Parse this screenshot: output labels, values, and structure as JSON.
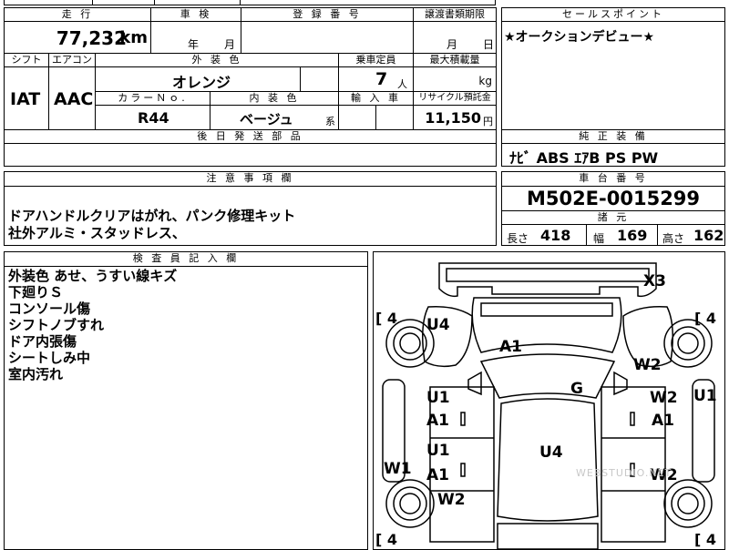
{
  "header_cut": {
    "top_left": "",
    "middle": "",
    "right_fragment": ""
  },
  "mileage": {
    "label": "走 行",
    "value": "77,232",
    "unit": "km"
  },
  "inspection": {
    "label": "車 検",
    "year_label": "年",
    "month_label": "月"
  },
  "registration": {
    "label": "登 録 番 号",
    "value": ""
  },
  "transfer_deadline": {
    "label": "譲渡書類期限",
    "month_label": "月",
    "day_label": "日"
  },
  "sales_point": {
    "label": "セールスポイント",
    "text": "★オークションデビュー★"
  },
  "shift": {
    "label": "シフト",
    "value": "IAT"
  },
  "aircon": {
    "label": "エアコン",
    "value": "AAC"
  },
  "exterior_color": {
    "label": "外 装 色",
    "value": "オレンジ"
  },
  "capacity": {
    "label": "乗車定員",
    "value": "7",
    "unit": "人"
  },
  "max_load": {
    "label": "最大積載量",
    "value": "",
    "unit": "kg"
  },
  "color_no": {
    "label": "カラーＮｏ.",
    "value": "R44"
  },
  "interior_color": {
    "label": "内 装 色",
    "value": "ベージュ",
    "suffix": "系"
  },
  "import": {
    "label": "輸 入 車",
    "value": ""
  },
  "recycle": {
    "label": "リサイクル預託金",
    "value": "11,150",
    "unit": "円"
  },
  "later_parts": {
    "label": "後 日 発 送 部 品",
    "value": ""
  },
  "genuine_equipment": {
    "label": "純 正 装 備",
    "value": "ﾅﾋﾞ ABS ｴｱB PS PW"
  },
  "notes": {
    "label": "注 意 事 項 欄",
    "lines": [
      "ドアハンドルクリアはがれ、パンク修理キット",
      "社外アルミ・スタッドレス、"
    ]
  },
  "chassis": {
    "label": "車 台 番 号",
    "value": "M502E-0015299"
  },
  "specs": {
    "label": "諸 元",
    "length_label": "長さ",
    "length": "418",
    "width_label": "幅",
    "width": "169",
    "height_label": "高さ",
    "height": "162"
  },
  "inspector": {
    "label": "検 査 員 記 入 欄",
    "lines": [
      "外装色 あせ、うすい線キズ",
      "下廻りＳ",
      "コンソール傷",
      "シフトノブすれ",
      "ドア内張傷",
      "シートしみ中",
      "室内汚れ"
    ]
  },
  "diagram": {
    "marks": {
      "x3": "X3",
      "a1_hood": "A1",
      "u4_front_left": "U4",
      "w2_front_right": "W2",
      "g_windshield": "G",
      "u1_left_front_door": "U1",
      "a1_left_front_door": "A1",
      "u1_left_rear_door": "U1",
      "a1_left_rear_door": "A1",
      "u4_roof": "U4",
      "w2_right_front_door": "W2",
      "a1_right_front_door": "A1",
      "u1_right_side": "U1",
      "w2_right_rear_door": "W2",
      "w1_left_side": "W1",
      "w2_left_rear_fender": "W2"
    },
    "tires": {
      "front_left": "4",
      "front_right": "4",
      "rear_left": "4",
      "rear_right": "4"
    },
    "watermark": "WEBSTUDIO.NET"
  }
}
